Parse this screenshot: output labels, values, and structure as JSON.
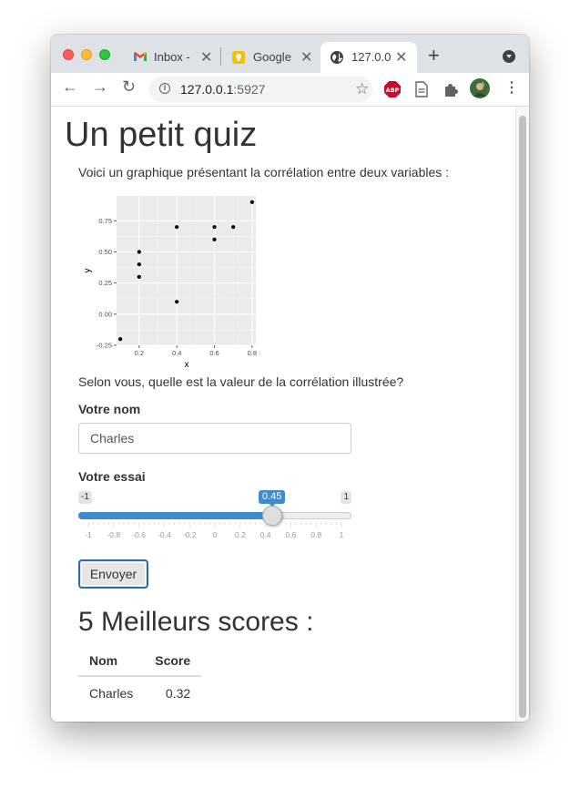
{
  "browser": {
    "tabs": [
      {
        "title": "Inbox -",
        "icon": "gmail-icon"
      },
      {
        "title": "Google",
        "icon": "google-keep-icon"
      },
      {
        "title": "127.0.0",
        "icon": "globe-icon",
        "active": true
      }
    ],
    "url_host": "127.0.0.1",
    "url_port": ":5927"
  },
  "page": {
    "title": "Un petit quiz",
    "intro": "Voici un graphique présentant la corrélation entre deux variables :",
    "question": "Selon vous, quelle est la valeur de la corrélation illustrée?",
    "name_label": "Votre nom",
    "name_value": "Charles",
    "guess_label": "Votre essai",
    "slider": {
      "min_label": "-1",
      "max_label": "1",
      "value_label": "0.45",
      "value": 0.45,
      "min": -1,
      "max": 1,
      "ticks": [
        "-1",
        "-0.8",
        "-0.6",
        "-0.4",
        "-0.2",
        "0",
        "0.2",
        "0.4",
        "0.6",
        "0.8",
        "1"
      ]
    },
    "submit_label": "Envoyer",
    "scores_title": "5 Meilleurs scores :",
    "scores_table": {
      "headers": [
        "Nom",
        "Score"
      ],
      "rows": [
        [
          "Charles",
          "0.32"
        ]
      ]
    }
  },
  "colors": {
    "slider_accent": "#428bca",
    "plot_panel": "#ebebeb"
  },
  "chart_data": {
    "type": "scatter",
    "xlabel": "x",
    "ylabel": "y",
    "xlim": [
      0.08,
      0.82
    ],
    "ylim": [
      -0.25,
      0.95
    ],
    "x_ticks": [
      "0.2",
      "0.4",
      "0.6",
      "0.8"
    ],
    "y_ticks": [
      "-0.25",
      "0.00",
      "0.25",
      "0.50",
      "0.75"
    ],
    "x_tick_values": [
      0.2,
      0.4,
      0.6,
      0.8
    ],
    "y_tick_values": [
      -0.25,
      0.0,
      0.25,
      0.5,
      0.75
    ],
    "points": [
      {
        "x": 0.1,
        "y": -0.2
      },
      {
        "x": 0.2,
        "y": 0.3
      },
      {
        "x": 0.2,
        "y": 0.4
      },
      {
        "x": 0.2,
        "y": 0.5
      },
      {
        "x": 0.4,
        "y": 0.1
      },
      {
        "x": 0.4,
        "y": 0.7
      },
      {
        "x": 0.6,
        "y": 0.6
      },
      {
        "x": 0.6,
        "y": 0.7
      },
      {
        "x": 0.7,
        "y": 0.7
      },
      {
        "x": 0.8,
        "y": 0.9
      }
    ],
    "grid": true
  }
}
